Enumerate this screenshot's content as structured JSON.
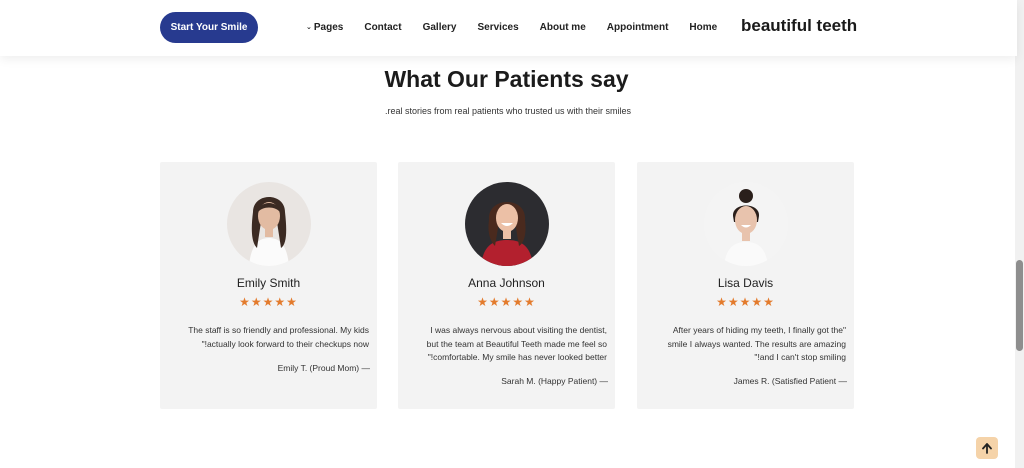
{
  "header": {
    "cta_label": "Start Your Smile",
    "brand": "beautiful teeth",
    "nav": [
      {
        "label": "Pages",
        "icon": "chevron-down-icon"
      },
      {
        "label": "Contact"
      },
      {
        "label": "Gallery"
      },
      {
        "label": "Services"
      },
      {
        "label": "About me"
      },
      {
        "label": "Appointment"
      },
      {
        "label": "Home"
      }
    ]
  },
  "section": {
    "title": "What Our Patients say",
    "subtitle": ".real stories from real patients who trusted us with their smiles"
  },
  "testimonials": [
    {
      "name": "Emily Smith",
      "stars": "★★★★★",
      "rating": 5,
      "quote_lines": [
        "The staff is so friendly and professional. My kids",
        "\"!actually look forward to their checkups now"
      ],
      "attribution": "Emily T. (Proud Mom) —"
    },
    {
      "name": "Anna Johnson",
      "stars": "★★★★★",
      "rating": 5,
      "quote_lines": [
        "I was always nervous about visiting the dentist,",
        "but the team at Beautiful Teeth made me feel so",
        "\"!comfortable. My smile has never looked better"
      ],
      "attribution": "Sarah M. (Happy Patient) —"
    },
    {
      "name": "Lisa Davis",
      "stars": "★★★★★",
      "rating": 5,
      "quote_lines": [
        "After years of hiding my teeth, I finally got the\"",
        "smile I always wanted. The results are amazing",
        "\"!and I can't stop smiling"
      ],
      "attribution": "James R. (Satisfied Patient —"
    }
  ],
  "colors": {
    "cta_bg": "#273a8f",
    "star": "#e37b2d",
    "card_bg": "#f3f3f3",
    "back_to_top_bg": "#f5d3a9"
  },
  "icons": {
    "back_to_top": "arrow-up-icon",
    "star": "star-icon"
  }
}
